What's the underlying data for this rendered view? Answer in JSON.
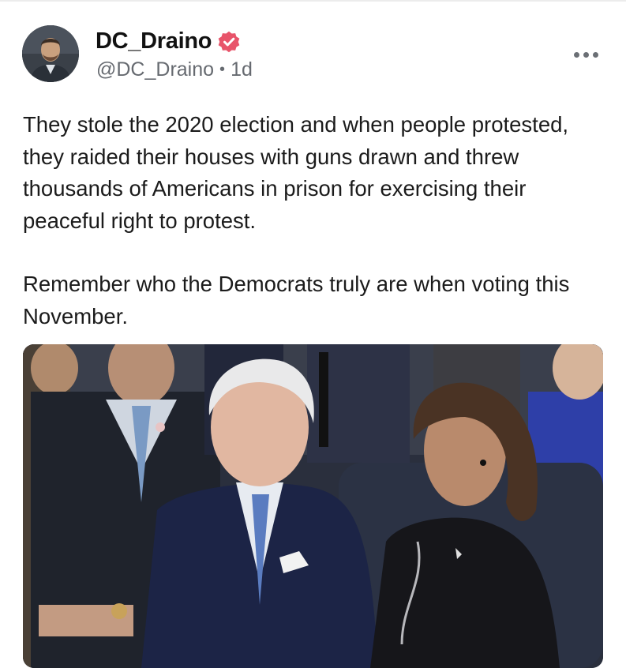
{
  "post": {
    "author": {
      "display_name": "DC_Draino",
      "handle": "@DC_Draino",
      "verified": true,
      "verified_badge_color": "#e8546a",
      "avatar_icon": "profile-photo"
    },
    "separator": "•",
    "timestamp": "1d",
    "more_icon": "more-horizontal-icon",
    "text_paragraphs": [
      "They stole the 2020 election and when people protested, they raided their houses with guns drawn and threw thousands of Americans in prison for exercising their peaceful right to protest.",
      "Remember who the Democrats truly are when voting this November."
    ],
    "media": {
      "type": "photo"
    }
  },
  "colors": {
    "text": "#1b1b1b",
    "secondary_text": "#666a70",
    "badge": "#e8546a"
  }
}
